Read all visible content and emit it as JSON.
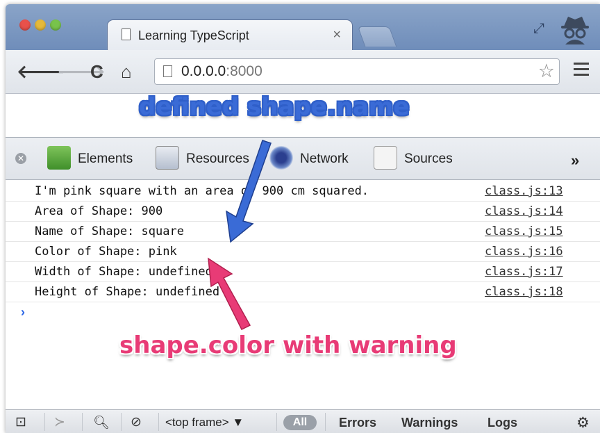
{
  "browser": {
    "tab_title": "Learning TypeScript",
    "tab_close": "×",
    "url_host": "0.0.0.0",
    "url_port": ":8000"
  },
  "annotations": {
    "top": "defined shape.name",
    "bottom": "shape.color with warning",
    "top_color": "#3a6bd6",
    "bottom_color": "#e83b76"
  },
  "devtools": {
    "tabs": [
      {
        "label": "Elements",
        "icon": "elements-icon"
      },
      {
        "label": "Resources",
        "icon": "resources-icon"
      },
      {
        "label": "Network",
        "icon": "network-icon"
      },
      {
        "label": "Sources",
        "icon": "sources-icon"
      }
    ],
    "more": "»"
  },
  "console": {
    "rows": [
      {
        "message": "I'm pink square with an area of 900 cm squared.",
        "source": "class.js:13"
      },
      {
        "message": "Area of Shape: 900",
        "source": "class.js:14"
      },
      {
        "message": "Name of Shape: square",
        "source": "class.js:15"
      },
      {
        "message": "Color of Shape: pink",
        "source": "class.js:16"
      },
      {
        "message": "Width of Shape: undefined",
        "source": "class.js:17"
      },
      {
        "message": "Height of Shape: undefined",
        "source": "class.js:18"
      }
    ],
    "prompt": "›"
  },
  "statusbar": {
    "frame": "<top frame> ▼",
    "all": "All",
    "errors": "Errors",
    "warnings": "Warnings",
    "logs": "Logs"
  }
}
